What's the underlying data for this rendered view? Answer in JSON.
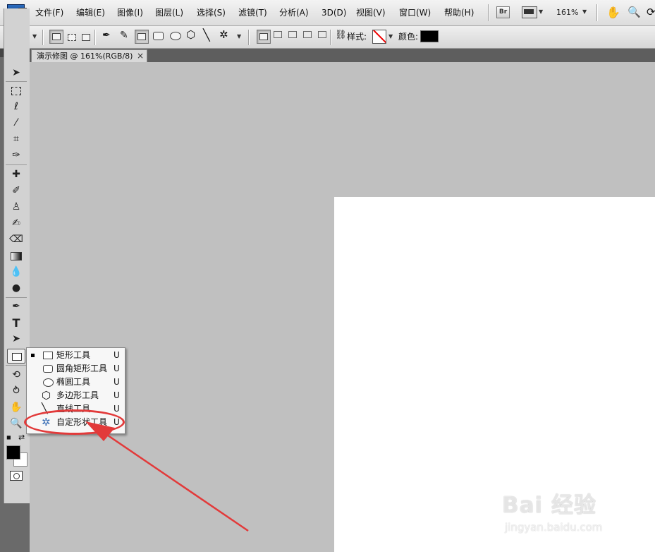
{
  "app": {
    "logo": "Ps"
  },
  "menu": [
    "文件(F)",
    "编辑(E)",
    "图像(I)",
    "图层(L)",
    "选择(S)",
    "滤镜(T)",
    "分析(A)",
    "3D(D)",
    "视图(V)",
    "窗口(W)",
    "帮助(H)"
  ],
  "menubar_right": {
    "bridge_label": "Br",
    "zoom": "161%"
  },
  "options_bar": {
    "style_label": "样式:",
    "color_label": "颜色:",
    "color_value": "#000000"
  },
  "document": {
    "tab_title": "演示修图 @ 161%(RGB/8)",
    "close_glyph": "×"
  },
  "toolbox_icons": [
    "move-tool-icon",
    "marquee-tool-icon",
    "lasso-tool-icon",
    "magic-wand-icon",
    "crop-tool-icon",
    "eyedropper-icon",
    "healing-brush-icon",
    "brush-tool-icon",
    "clone-stamp-icon",
    "history-brush-icon",
    "eraser-icon",
    "gradient-icon",
    "blur-icon",
    "dodge-icon",
    "pen-tool-icon",
    "type-tool-icon",
    "path-select-icon",
    "rectangle-tool-icon",
    "3d-rotate-icon",
    "3d-orbit-icon",
    "hand-tool-icon",
    "zoom-tool-icon"
  ],
  "type_tool_glyph": "T",
  "flyout": {
    "items": [
      {
        "label": "矩形工具",
        "key": "U",
        "icon": "rectangle-icon",
        "selected": true
      },
      {
        "label": "圆角矩形工具",
        "key": "U",
        "icon": "rounded-rectangle-icon",
        "selected": false
      },
      {
        "label": "椭圆工具",
        "key": "U",
        "icon": "ellipse-icon",
        "selected": false
      },
      {
        "label": "多边形工具",
        "key": "U",
        "icon": "polygon-icon",
        "selected": false
      },
      {
        "label": "直线工具",
        "key": "U",
        "icon": "line-icon",
        "selected": false
      },
      {
        "label": "自定形状工具",
        "key": "U",
        "icon": "custom-shape-icon",
        "selected": false
      }
    ]
  },
  "annotation": {
    "color": "#e23a3a"
  },
  "watermark": {
    "main": "Bai 经验",
    "sub": "jingyan.baidu.com"
  }
}
